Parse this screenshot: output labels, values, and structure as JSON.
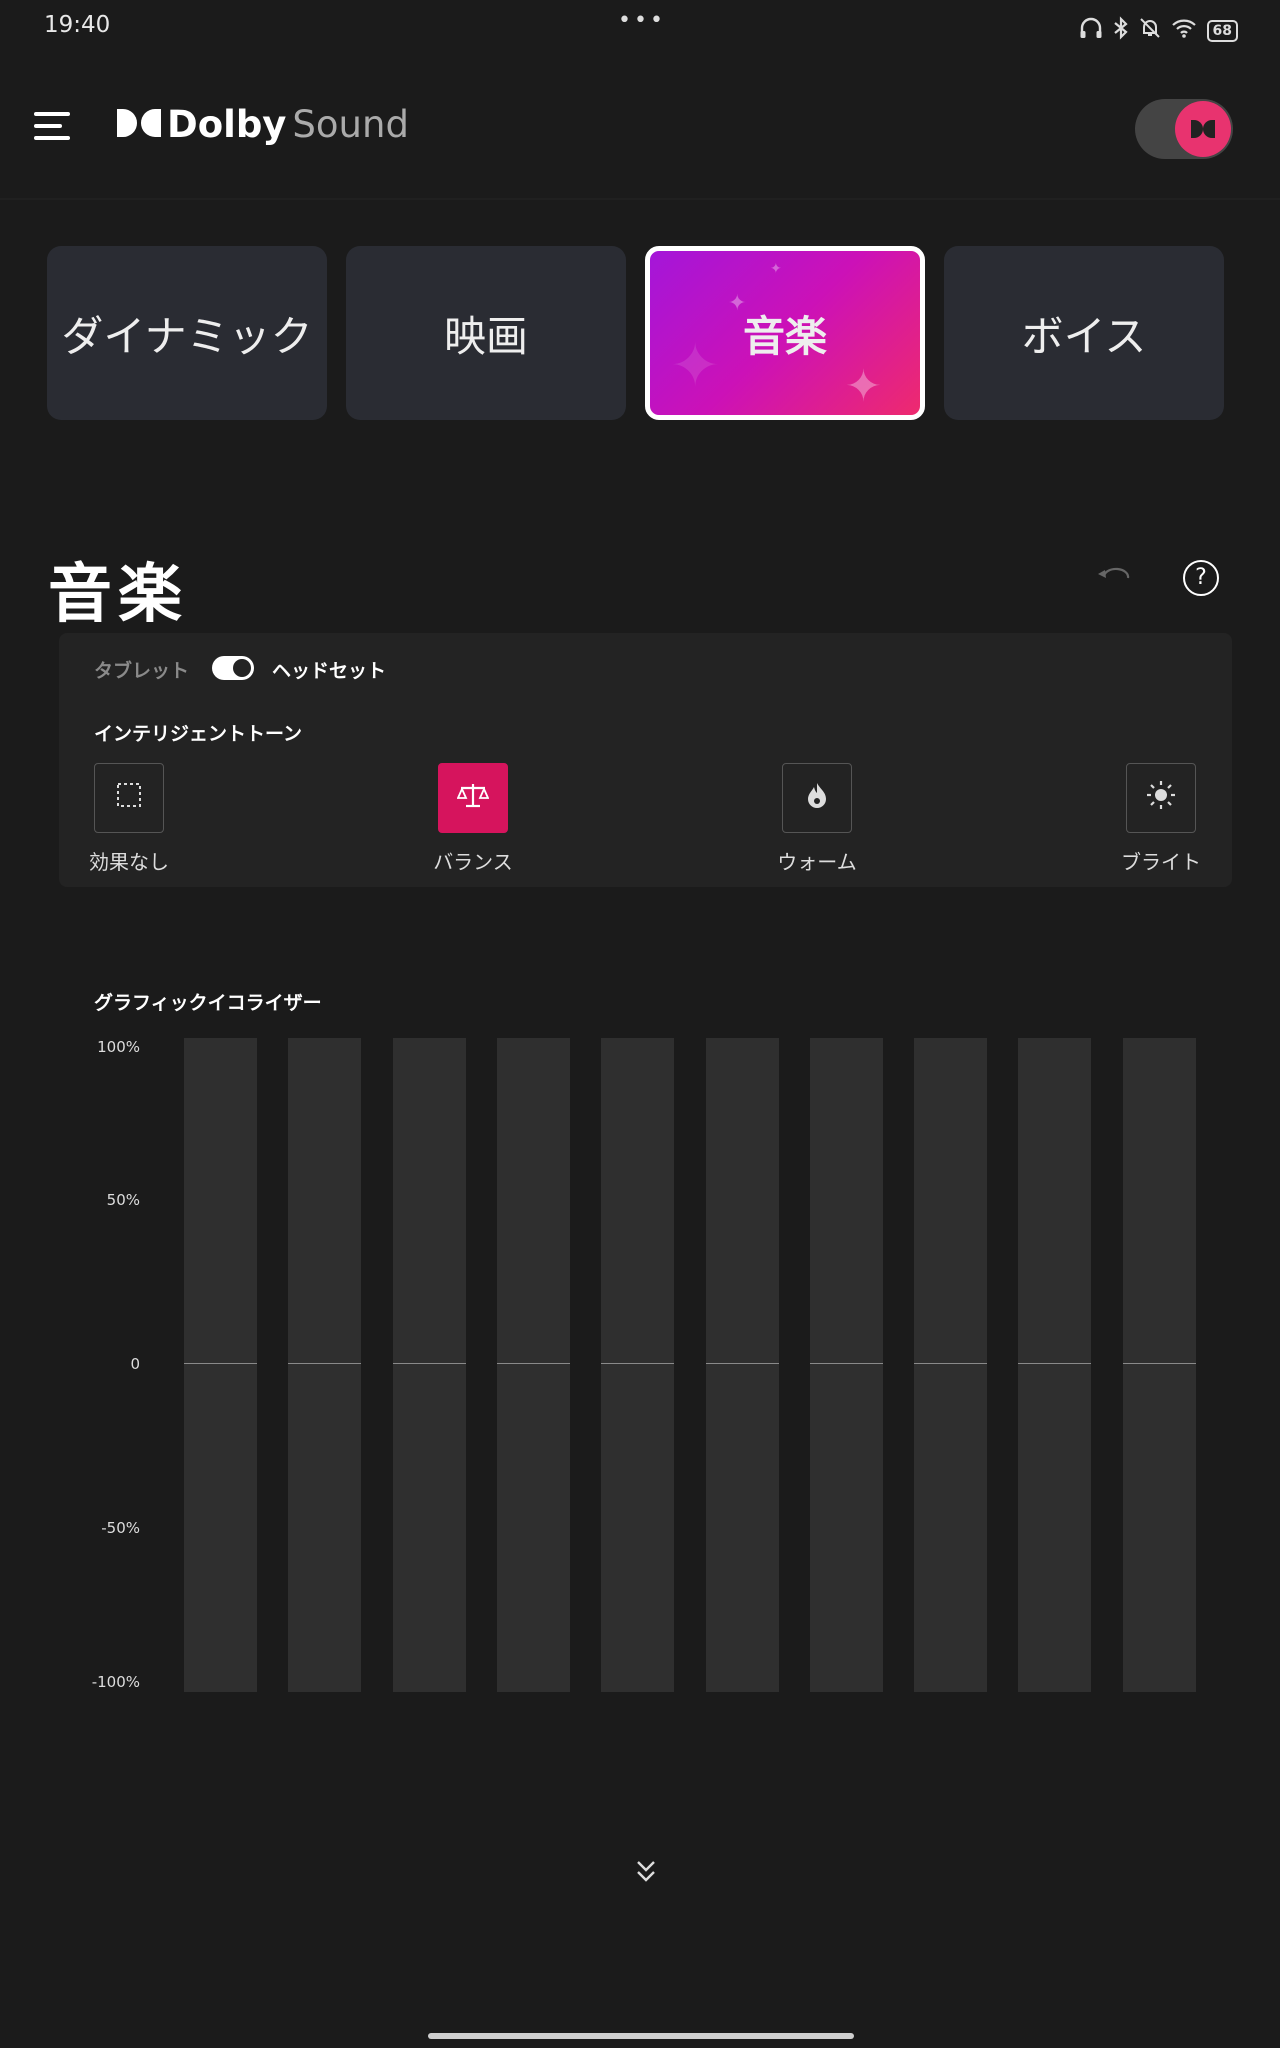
{
  "status_bar": {
    "time": "19:40",
    "dots": "•••",
    "battery": "68",
    "icons": [
      "headphones-icon",
      "bluetooth-icon",
      "bell-off-icon",
      "wifi-icon",
      "battery-icon"
    ]
  },
  "header": {
    "brand": "Dolby",
    "product": "Sound",
    "dolby_enabled": true,
    "accent_color": "#e8336f"
  },
  "profiles": [
    {
      "label": "ダイナミック",
      "active": false
    },
    {
      "label": "映画",
      "active": false
    },
    {
      "label": "音楽",
      "active": true
    },
    {
      "label": "ボイス",
      "active": false
    }
  ],
  "section": {
    "title": "音楽",
    "help_symbol": "?"
  },
  "device": {
    "left_label": "タブレット",
    "right_label": "ヘッドセット",
    "selected": "ヘッドセット"
  },
  "intelligent_tone": {
    "label": "インテリジェントトーン",
    "options": [
      {
        "label": "効果なし",
        "icon": "no-effect-icon",
        "active": false
      },
      {
        "label": "バランス",
        "icon": "balance-scale-icon",
        "active": true
      },
      {
        "label": "ウォーム",
        "icon": "flame-icon",
        "active": false
      },
      {
        "label": "ブライト",
        "icon": "sun-icon",
        "active": false
      }
    ]
  },
  "equalizer": {
    "label": "グラフィックイコライザー",
    "y_ticks": [
      "100%",
      "50%",
      "0",
      "-50%",
      "-100%"
    ],
    "bands": [
      0,
      0,
      0,
      0,
      0,
      0,
      0,
      0,
      0,
      0
    ]
  }
}
